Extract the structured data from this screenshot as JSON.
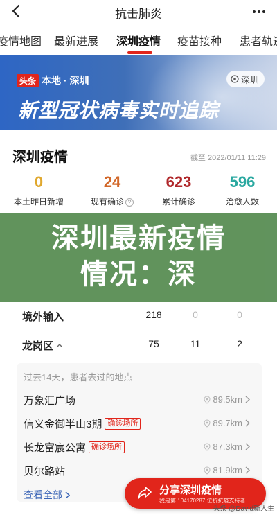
{
  "header": {
    "title": "抗击肺炎"
  },
  "tabs": [
    {
      "label": "疫情地图"
    },
    {
      "label": "最新进展"
    },
    {
      "label": "深圳疫情",
      "active": true
    },
    {
      "label": "疫苗接种"
    },
    {
      "label": "患者轨迹"
    }
  ],
  "banner": {
    "badge": "头条",
    "local": "本地 · 深圳",
    "location": "深圳",
    "title": "新型冠状病毒实时追踪"
  },
  "section": {
    "title": "深圳疫情",
    "date": "截至 2022/01/11 11:29"
  },
  "stats": [
    {
      "value": "0",
      "label": "本土昨日新增",
      "color": "#e0a82e"
    },
    {
      "value": "24",
      "label": "现有确诊",
      "color": "#d2682a",
      "help": true
    },
    {
      "value": "623",
      "label": "累计确诊",
      "color": "#b0282b"
    },
    {
      "value": "596",
      "label": "治愈人数",
      "color": "#2aa8a0"
    }
  ],
  "overlay": {
    "text": "深圳最新疫情情况：深"
  },
  "table": [
    {
      "name": "境外输入",
      "values": [
        "218",
        "0",
        "0"
      ]
    },
    {
      "name": "龙岗区",
      "values": [
        "75",
        "11",
        "2"
      ],
      "expanded": true
    }
  ],
  "places": {
    "note": "过去14天，患者去过的地点",
    "items": [
      {
        "name": "万象汇广场",
        "tag": "",
        "distance": "89.5km"
      },
      {
        "name": "信义金御半山3期",
        "tag": "确诊场所",
        "distance": "89.7km"
      },
      {
        "name": "长龙富宸公寓",
        "tag": "确诊场所",
        "distance": "87.3km"
      },
      {
        "name": "贝尔路站",
        "tag": "",
        "distance": "81.9km"
      }
    ],
    "view_all": "查看全部"
  },
  "share": {
    "title": "分享深圳疫情",
    "subtitle": "我是第 104170287 位抗抗疫支持者"
  },
  "watermark": "头条 @David新人生"
}
